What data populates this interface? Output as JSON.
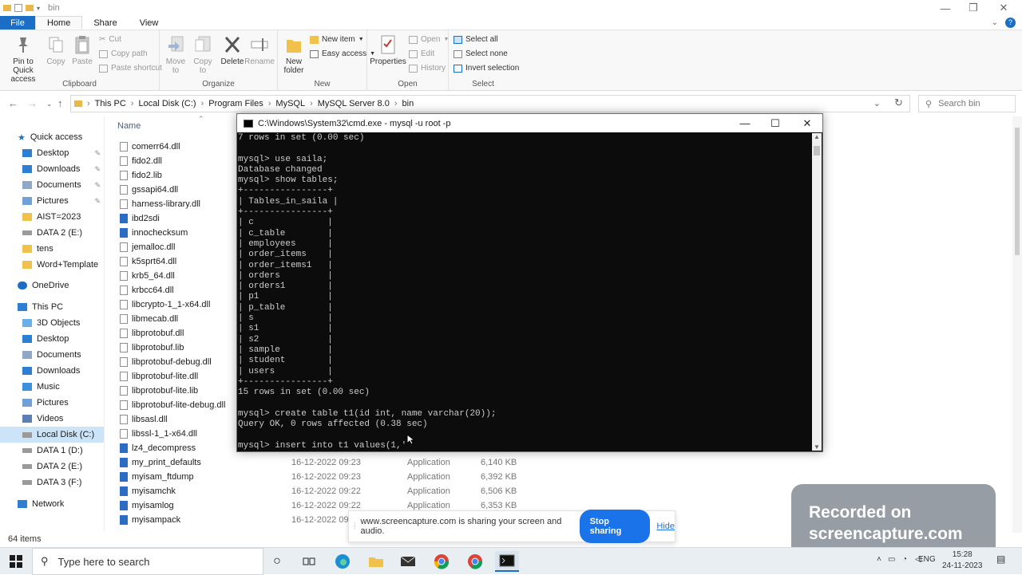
{
  "window": {
    "title": "bin",
    "minimize": "—",
    "maximize": "❐",
    "close": "✕"
  },
  "ribbon_tabs": [
    "File",
    "Home",
    "Share",
    "View"
  ],
  "ribbon": {
    "clipboard": {
      "label": "Clipboard",
      "pin": "Pin to Quick access",
      "copy": "Copy",
      "paste": "Paste",
      "cut": "Cut",
      "copy_path": "Copy path",
      "paste_shortcut": "Paste shortcut"
    },
    "organize": {
      "label": "Organize",
      "move_to": "Move to",
      "copy_to": "Copy to",
      "delete": "Delete",
      "rename": "Rename"
    },
    "new": {
      "label": "New",
      "new_folder": "New folder",
      "new_item": "New item",
      "easy_access": "Easy access"
    },
    "open": {
      "label": "Open",
      "properties": "Properties",
      "open": "Open",
      "edit": "Edit",
      "history": "History"
    },
    "select": {
      "label": "Select",
      "select_all": "Select all",
      "select_none": "Select none",
      "invert": "Invert selection"
    }
  },
  "address": {
    "crumbs": [
      "This PC",
      "Local Disk (C:)",
      "Program Files",
      "MySQL",
      "MySQL Server 8.0",
      "bin"
    ],
    "search_placeholder": "Search bin"
  },
  "nav": {
    "quick_access": "Quick access",
    "quick_items": [
      "Desktop",
      "Downloads",
      "Documents",
      "Pictures",
      "AIST=2023",
      "DATA 2 (E:)",
      "tens",
      "Word+Template"
    ],
    "onedrive": "OneDrive",
    "this_pc": "This PC",
    "pc_items": [
      "3D Objects",
      "Desktop",
      "Documents",
      "Downloads",
      "Music",
      "Pictures",
      "Videos",
      "Local Disk (C:)",
      "DATA 1 (D:)",
      "DATA 2 (E:)",
      "DATA 3 (F:)"
    ],
    "network": "Network"
  },
  "columns": {
    "name": "Name"
  },
  "files": [
    {
      "name": "comerr64.dll"
    },
    {
      "name": "fido2.dll"
    },
    {
      "name": "fido2.lib"
    },
    {
      "name": "gssapi64.dll"
    },
    {
      "name": "harness-library.dll"
    },
    {
      "name": "ibd2sdi"
    },
    {
      "name": "innochecksum"
    },
    {
      "name": "jemalloc.dll"
    },
    {
      "name": "k5sprt64.dll"
    },
    {
      "name": "krb5_64.dll"
    },
    {
      "name": "krbcc64.dll"
    },
    {
      "name": "libcrypto-1_1-x64.dll"
    },
    {
      "name": "libmecab.dll"
    },
    {
      "name": "libprotobuf.dll"
    },
    {
      "name": "libprotobuf.lib"
    },
    {
      "name": "libprotobuf-debug.dll"
    },
    {
      "name": "libprotobuf-lite.dll"
    },
    {
      "name": "libprotobuf-lite.lib"
    },
    {
      "name": "libprotobuf-lite-debug.dll"
    },
    {
      "name": "libsasl.dll"
    },
    {
      "name": "libssl-1_1-x64.dll"
    },
    {
      "name": "lz4_decompress"
    },
    {
      "name": "my_print_defaults",
      "date": "16-12-2022 09:23",
      "type": "Application",
      "size": "6,140 KB"
    },
    {
      "name": "myisam_ftdump",
      "date": "16-12-2022 09:23",
      "type": "Application",
      "size": "6,392 KB"
    },
    {
      "name": "myisamchk",
      "date": "16-12-2022 09:22",
      "type": "Application",
      "size": "6,506 KB"
    },
    {
      "name": "myisamlog",
      "date": "16-12-2022 09:22",
      "type": "Application",
      "size": "6,353 KB"
    },
    {
      "name": "myisampack",
      "date": "16-12-2022 09:22",
      "type": "Application",
      "size": ""
    }
  ],
  "status": {
    "items": "64 items"
  },
  "cmd": {
    "title": "C:\\Windows\\System32\\cmd.exe - mysql  -u root -p",
    "output": "7 rows in set (0.00 sec)\n\nmysql> use saila;\nDatabase changed\nmysql> show tables;\n+----------------+\n| Tables_in_saila |\n+----------------+\n| c              |\n| c_table        |\n| employees      |\n| order_items    |\n| order_items1   |\n| orders         |\n| orders1        |\n| p1             |\n| p_table        |\n| s              |\n| s1             |\n| s2             |\n| sample         |\n| student        |\n| users          |\n+----------------+\n15 rows in set (0.00 sec)\n\nmysql> create table t1(id int, name varchar(20));\nQuery OK, 0 rows affected (0.38 sec)\n\nmysql> insert into t1 values(1,'"
  },
  "share_bar": {
    "message": "www.screencapture.com is sharing your screen and audio.",
    "stop": "Stop sharing",
    "hide": "Hide"
  },
  "watermark": {
    "line1": "Recorded on",
    "line2": "screencapture.com"
  },
  "taskbar": {
    "search": "Type here to search",
    "lang": "ENG",
    "time": "15:28",
    "date": "24-11-2023"
  }
}
